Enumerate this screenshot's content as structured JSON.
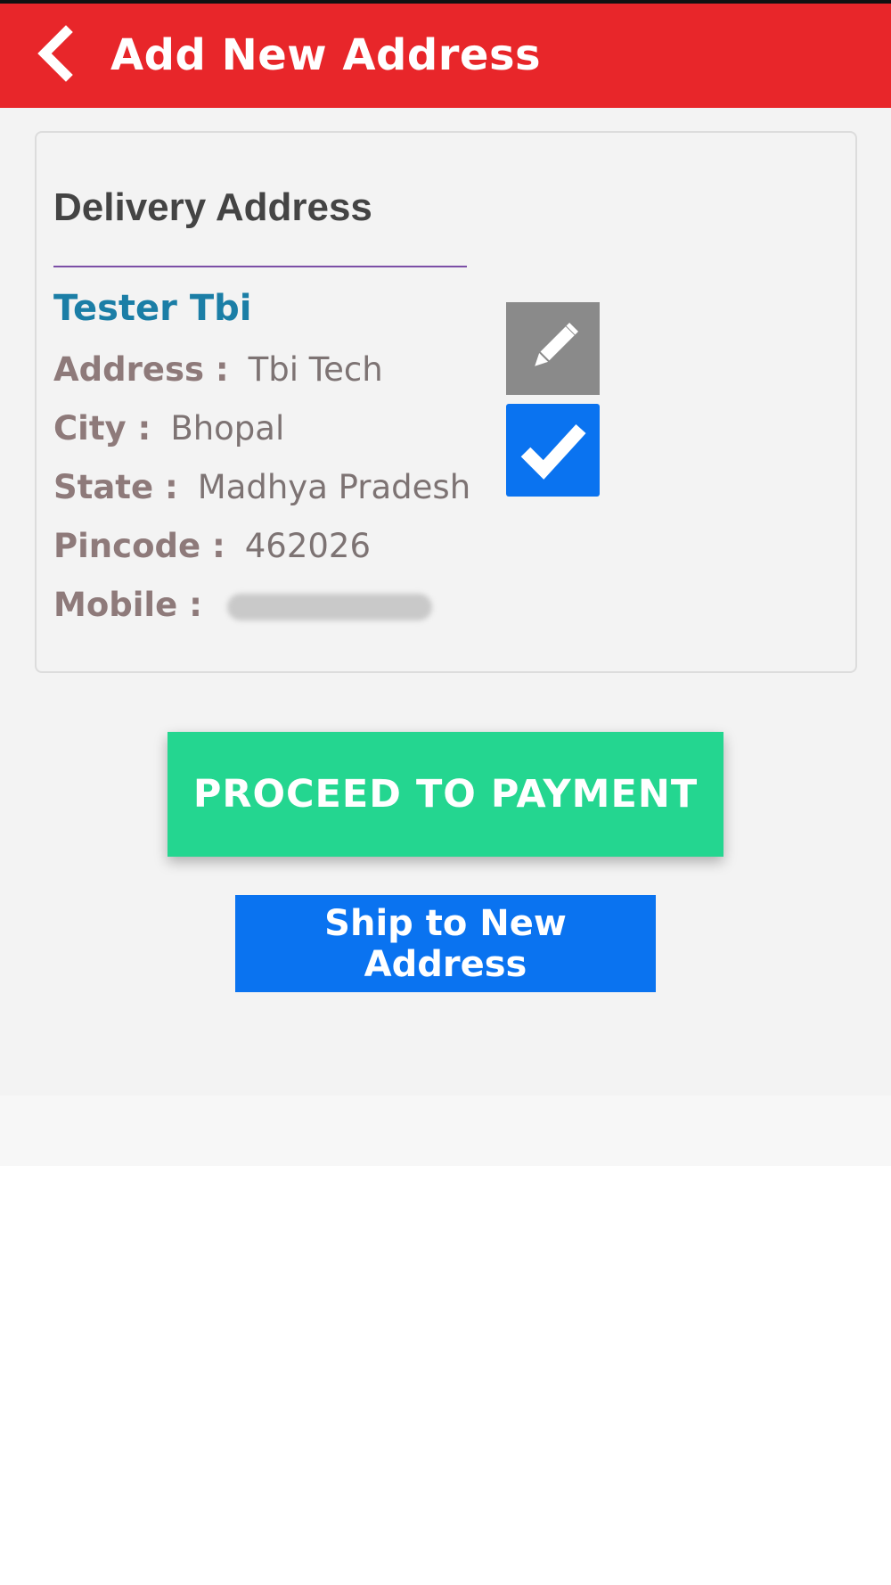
{
  "header": {
    "back_icon": "chevron-left-icon",
    "title": "Add New Address"
  },
  "card": {
    "heading": "Delivery Address",
    "name": "Tester Tbi",
    "fields": [
      {
        "label": "Address :",
        "value": "Tbi Tech"
      },
      {
        "label": "City :",
        "value": "Bhopal"
      },
      {
        "label": "State :",
        "value": "Madhya Pradesh"
      },
      {
        "label": "Pincode :",
        "value": "462026"
      },
      {
        "label": "Mobile :",
        "value": ""
      }
    ],
    "edit_icon": "pencil-icon",
    "select_icon": "checkmark-icon"
  },
  "actions": {
    "proceed_label": "PROCEED TO PAYMENT",
    "ship_label": "Ship to New Address"
  },
  "colors": {
    "app_bar": "#e8262a",
    "proceed": "#24d690",
    "ship": "#0a73f0",
    "name": "#1b7ea6"
  }
}
